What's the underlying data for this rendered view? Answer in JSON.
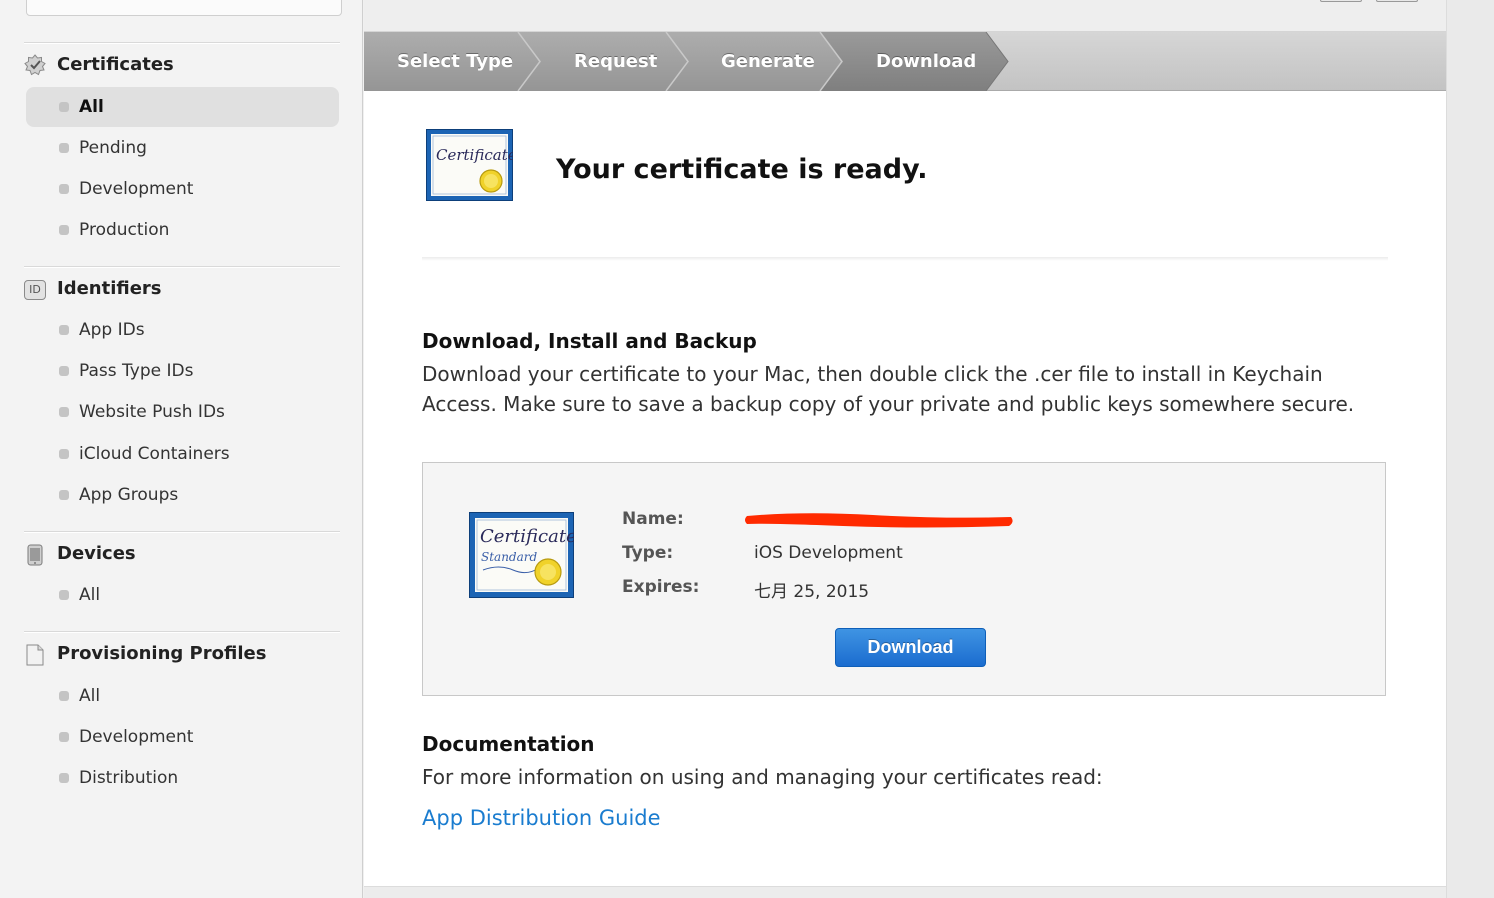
{
  "sidebar": {
    "certificates": {
      "title": "Certificates",
      "icon": "certificate-badge-icon",
      "items": [
        "All",
        "Pending",
        "Development",
        "Production"
      ],
      "selected": "All"
    },
    "identifiers": {
      "title": "Identifiers",
      "icon": "id-icon",
      "icon_text": "ID",
      "items": [
        "App IDs",
        "Pass Type IDs",
        "Website Push IDs",
        "iCloud Containers",
        "App Groups"
      ]
    },
    "devices": {
      "title": "Devices",
      "icon": "device-icon",
      "items": [
        "All"
      ]
    },
    "profiles": {
      "title": "Provisioning Profiles",
      "icon": "document-icon",
      "items": [
        "All",
        "Development",
        "Distribution"
      ]
    }
  },
  "stepper": {
    "steps": [
      "Select Type",
      "Request",
      "Generate",
      "Download"
    ],
    "current_index": 3
  },
  "header": {
    "title": "Your certificate is ready.",
    "icon": "certificate-icon",
    "icon_text": "Certificate"
  },
  "install_section": {
    "heading": "Download, Install and Backup",
    "text": "Download your certificate to your Mac, then double click the .cer file to install in Keychain Access. Make sure to save a backup copy of your private and public keys somewhere secure."
  },
  "certificate": {
    "icon": "certificate-standard-icon",
    "icon_title": "Certificate",
    "icon_subtitle": "Standard",
    "name_label": "Name:",
    "type_label": "Type:",
    "type_value": "iOS Development",
    "expires_label": "Expires:",
    "expires_value": "七月 25, 2015",
    "download_label": "Download"
  },
  "documentation": {
    "heading": "Documentation",
    "text": "For more information on using and managing your certificates read:",
    "link": "App Distribution Guide"
  },
  "colors": {
    "link": "#1a7ccf",
    "button": "#1b6ccf",
    "redaction": "#ff2a00",
    "step_current": "#8c8c8c",
    "step_other": "#a6a6a6"
  }
}
